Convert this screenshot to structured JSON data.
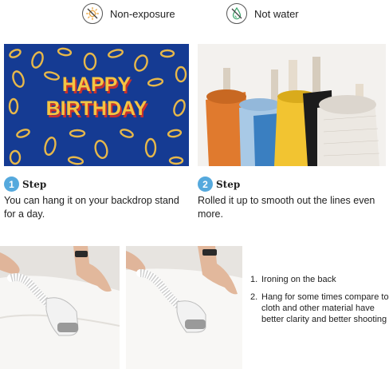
{
  "care": [
    {
      "icon": "sun-crossed-icon",
      "label": "Non-exposure"
    },
    {
      "icon": "water-crossed-icon",
      "label": "Not water"
    }
  ],
  "banner": {
    "line1": "HAPPY",
    "line2": "BIRTHDAY"
  },
  "steps": [
    {
      "number": "1",
      "word": "Step",
      "text": "You can hang it on your backdrop stand for a day."
    },
    {
      "number": "2",
      "word": "Step",
      "text": "Rolled it up to smooth out the lines even more."
    }
  ],
  "notes": [
    {
      "number": "1.",
      "text": "Ironing on the back"
    },
    {
      "number": "2.",
      "text": "Hang for some times compare to cloth and other material have better clarity and better shooting"
    }
  ],
  "colors": {
    "banner_bg": "#153b93",
    "banner_text": "#f4c542",
    "banner_shadow": "#c9302c",
    "step_badge": "#55a9dd"
  }
}
